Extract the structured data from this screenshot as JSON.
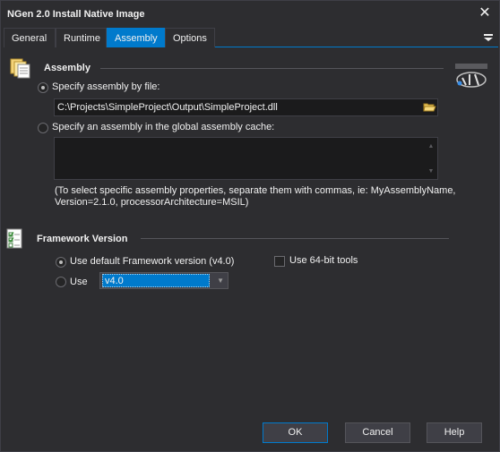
{
  "window": {
    "title": "NGen 2.0 Install Native Image",
    "close_glyph": "✕"
  },
  "tabs": [
    {
      "label": "General",
      "active": false
    },
    {
      "label": "Runtime",
      "active": false
    },
    {
      "label": "Assembly",
      "active": true
    },
    {
      "label": "Options",
      "active": false
    }
  ],
  "tab_menu_icon": "hamburger-menu-icon",
  "assembly": {
    "header": "Assembly",
    "icon": "assembly-documents-icon",
    "logo_icon": "dotnet-logo-icon",
    "specify_by_file": {
      "label": "Specify assembly by file:",
      "checked": true
    },
    "file_path": "C:\\Projects\\SimpleProject\\Output\\SimpleProject.dll",
    "browse_icon": "folder-open-icon",
    "specify_gac": {
      "label": "Specify an assembly in the global assembly cache:",
      "checked": false
    },
    "gac_value": "",
    "hint_line1": "(To select specific assembly properties, separate them with commas, ie: MyAssemblyName,",
    "hint_line2": "Version=2.1.0, processorArchitecture=MSIL)"
  },
  "framework": {
    "header": "Framework Version",
    "icon": "checklist-icon",
    "use_default": {
      "label": "Use default Framework version (v4.0)",
      "checked": true
    },
    "use_64bit": {
      "label": "Use 64-bit tools",
      "checked": false
    },
    "use_specific": {
      "label": "Use",
      "checked": false
    },
    "version_value": "v4.0"
  },
  "buttons": {
    "ok": "OK",
    "cancel": "Cancel",
    "help": "Help"
  },
  "colors": {
    "accent": "#007acc",
    "background": "#2d2d30",
    "field": "#1b1b1c"
  }
}
